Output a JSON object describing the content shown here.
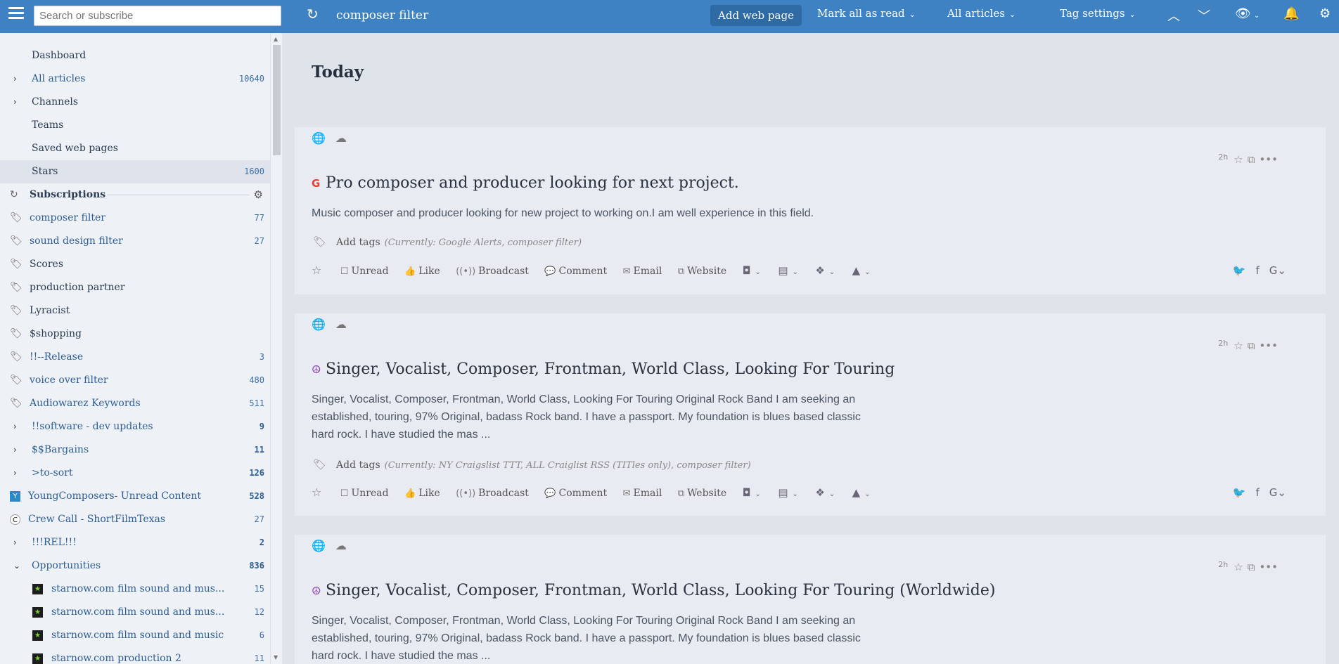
{
  "topbar": {
    "search_placeholder": "Search or subscribe",
    "feed_title": "composer filter",
    "add_web_page": "Add web page",
    "mark_all_as_read": "Mark all as read",
    "all_articles": "All articles",
    "tag_settings": "Tag settings"
  },
  "sidebar": {
    "dashboard": "Dashboard",
    "all_articles": {
      "label": "All articles",
      "count": "10640"
    },
    "channels": "Channels",
    "teams": "Teams",
    "saved_web_pages": "Saved web pages",
    "stars": {
      "label": "Stars",
      "count": "1600"
    },
    "subscriptions": "Subscriptions",
    "tags": [
      {
        "label": "composer filter",
        "count": "77"
      },
      {
        "label": "sound design filter",
        "count": "27"
      },
      {
        "label": "Scores",
        "count": ""
      },
      {
        "label": "production partner",
        "count": ""
      },
      {
        "label": "Lyracist",
        "count": ""
      },
      {
        "label": "$shopping",
        "count": ""
      },
      {
        "label": "!!--Release",
        "count": "3"
      },
      {
        "label": "voice over filter",
        "count": "480"
      },
      {
        "label": "Audiowarez Keywords",
        "count": "511"
      }
    ],
    "folders": [
      {
        "label": "!!software - dev updates",
        "count": "9"
      },
      {
        "label": "$$Bargains",
        "count": "11"
      },
      {
        "label": ">to-sort",
        "count": "126"
      }
    ],
    "feeds": [
      {
        "label": "YoungComposers- Unread Content",
        "count": "528",
        "icon": "Y"
      },
      {
        "label": "Crew Call - ShortFilmTexas",
        "count": "27",
        "icon": "C"
      }
    ],
    "rel": {
      "label": "!!!REL!!!",
      "count": "2"
    },
    "opportunities": {
      "label": "Opportunities",
      "count": "836"
    },
    "opp_items": [
      {
        "label": "starnow.com film sound and mus...",
        "count": "15"
      },
      {
        "label": "starnow.com film sound and mus...",
        "count": "12"
      },
      {
        "label": "starnow.com film sound and music",
        "count": "6"
      },
      {
        "label": "starnow.com production 2",
        "count": "11"
      }
    ]
  },
  "main": {
    "heading": "Today",
    "articles": [
      {
        "age": "2h",
        "title": "Pro composer and producer looking for next project.",
        "description": "Music composer and producer looking for new project to working on.I am well experience in this field.",
        "currently": "(Currently: Google Alerts, composer filter)"
      },
      {
        "age": "2h",
        "title": "Singer, Vocalist, Composer, Frontman, World Class, Looking For Touring",
        "description": "Singer, Vocalist, Composer, Frontman, World Class, Looking For Touring Original Rock Band I am seeking an established, touring, 97% Original, badass Rock band. I have a passport. My foundation is blues based classic hard rock. I have studied the mas ...",
        "currently": "(Currently: NY Craigslist TTT, ALL Craiglist RSS (TITles only), composer filter)"
      },
      {
        "age": "2h",
        "title": "Singer, Vocalist, Composer, Frontman, World Class, Looking For Touring (Worldwide)",
        "description": "Singer, Vocalist, Composer, Frontman, World Class, Looking For Touring Original Rock Band I am seeking an established, touring, 97% Original, badass Rock band. I have a passport. My foundation is blues based classic hard rock. I have studied the mas ..."
      }
    ],
    "actions": {
      "add_tags": "Add tags",
      "unread": "Unread",
      "like": "Like",
      "broadcast": "Broadcast",
      "comment": "Comment",
      "email": "Email",
      "website": "Website"
    }
  }
}
